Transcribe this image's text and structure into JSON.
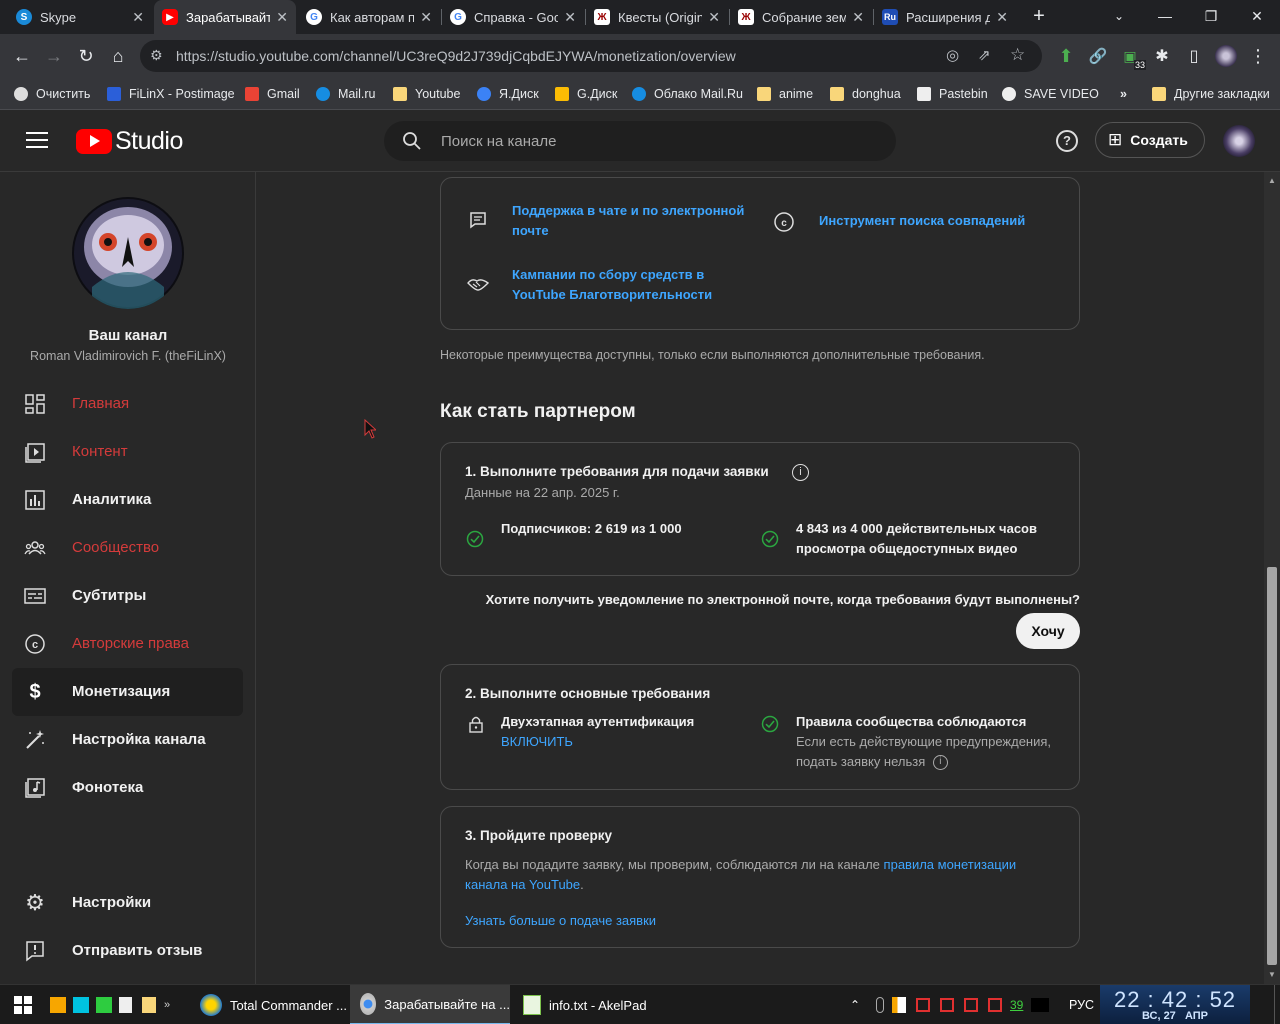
{
  "browser": {
    "tabs": [
      {
        "title": "Skype",
        "icon": "skype-icon",
        "color": "#1a8ad8"
      },
      {
        "title": "Зарабатывайте на YouTube",
        "icon": "youtube-icon",
        "color": "#ff0000",
        "active": true
      },
      {
        "title": "Как авторам получить",
        "icon": "google-icon",
        "color": "#ffffff"
      },
      {
        "title": "Справка - Google",
        "icon": "google-icon",
        "color": "#ffffff"
      },
      {
        "title": "Квесты (Original)",
        "icon": "quest-icon",
        "color": "#ffffff"
      },
      {
        "title": "Собрание земли",
        "icon": "quest-icon",
        "color": "#ffffff"
      },
      {
        "title": "Расширения для",
        "icon": "ru-icon",
        "color": "#1f4db4"
      }
    ],
    "url": "https://studio.youtube.com/channel/UC3reQ9d2J739djCqbdEJYWA/monetization/overview",
    "extension_badge": "33",
    "bookmarks": [
      {
        "label": "Очистить",
        "icon": "gear-icon"
      },
      {
        "label": "FiLinX - Postimage",
        "icon": "postimage-icon"
      },
      {
        "label": "Gmail",
        "icon": "gmail-icon"
      },
      {
        "label": "Mail.ru",
        "icon": "mailru-icon"
      },
      {
        "label": "Youtube",
        "icon": "folder-icon"
      },
      {
        "label": "Я.Диск",
        "icon": "yadisk-icon"
      },
      {
        "label": "G.Диск",
        "icon": "gdrive-icon"
      },
      {
        "label": "Облако Mail.Ru",
        "icon": "cloud-icon"
      },
      {
        "label": "anime",
        "icon": "folder-icon"
      },
      {
        "label": "donghua",
        "icon": "folder-icon"
      },
      {
        "label": "Pastebin",
        "icon": "pastebin-icon"
      },
      {
        "label": "SAVE VIDEO",
        "icon": "globe-icon"
      }
    ],
    "other_bookmarks": "Другие закладки",
    "more_bookmarks": "»"
  },
  "header": {
    "logo_text": "Studio",
    "search_placeholder": "Поиск на канале",
    "create_label": "Создать"
  },
  "sidebar": {
    "channel_title": "Ваш канал",
    "channel_name": "Roman Vladimirovich F. (theFiLinX)",
    "items": [
      {
        "label": "Главная",
        "icon": "dashboard-icon",
        "red": true
      },
      {
        "label": "Контент",
        "icon": "content-icon",
        "red": true
      },
      {
        "label": "Аналитика",
        "icon": "analytics-icon"
      },
      {
        "label": "Сообщество",
        "icon": "community-icon",
        "red": true
      },
      {
        "label": "Субтитры",
        "icon": "subtitles-icon"
      },
      {
        "label": "Авторские права",
        "icon": "copyright-icon",
        "red": true
      },
      {
        "label": "Монетизация",
        "icon": "dollar-icon",
        "selected": true
      },
      {
        "label": "Настройка канала",
        "icon": "wand-icon"
      },
      {
        "label": "Фонотека",
        "icon": "audio-library-icon"
      }
    ],
    "bottom": [
      {
        "label": "Настройки",
        "icon": "gear-icon"
      },
      {
        "label": "Отправить отзыв",
        "icon": "feedback-icon"
      }
    ]
  },
  "main": {
    "benefits": [
      {
        "label": "Поддержка в чате и по электронной почте",
        "icon": "chat-icon"
      },
      {
        "label": "Инструмент поиска совпадений",
        "icon": "copyright-icon"
      },
      {
        "label": "Кампании по сбору средств в YouTube Благотворительности",
        "icon": "handshake-icon"
      }
    ],
    "benefits_note": "Некоторые преимущества доступны, только если выполняются дополнительные требования.",
    "partner_heading": "Как стать партнером",
    "step1": {
      "title": "1. Выполните требования для подачи заявки",
      "date": "Данные на 22 апр. 2025 г.",
      "subscribers": "Подписчиков: 2 619 из 1 000",
      "hours": "4 843 из 4 000 действительных часов просмотра общедоступных видео"
    },
    "notify_question": "Хотите получить уведомление по электронной почте, когда требования будут выполнены?",
    "notify_button": "Хочу",
    "step2": {
      "title": "2. Выполните основные требования",
      "twofa": "Двухэтапная аутентификация",
      "twofa_action": "ВКЛЮЧИТЬ",
      "guidelines": "Правила сообщества соблюдаются",
      "guidelines_note": "Если есть действующие предупреждения, подать заявку нельзя"
    },
    "step3": {
      "title": "3. Пройдите проверку",
      "text": "Когда вы подадите заявку, мы проверим, соблюдаются ли на канале",
      "link": "правила монетизации канала на YouTube",
      "period": ".",
      "learn_more": "Узнать больше о подаче заявки"
    }
  },
  "taskbar": {
    "apps": [
      {
        "label": "Total Commander ...",
        "icon": "total-commander-icon"
      },
      {
        "label": "Зарабатывайте на ...",
        "icon": "chrome-icon",
        "active": true
      },
      {
        "label": "info.txt - AkelPad",
        "icon": "akelpad-icon"
      }
    ],
    "tray_number": "39",
    "lang": "РУС",
    "time": "22 : 42 : 52",
    "date": "ВС, 27   АПР"
  },
  "colors": {
    "accent": "#3ea6ff",
    "red": "#d43b3b",
    "youtube": "#ff0000",
    "check": "#2ba640"
  }
}
